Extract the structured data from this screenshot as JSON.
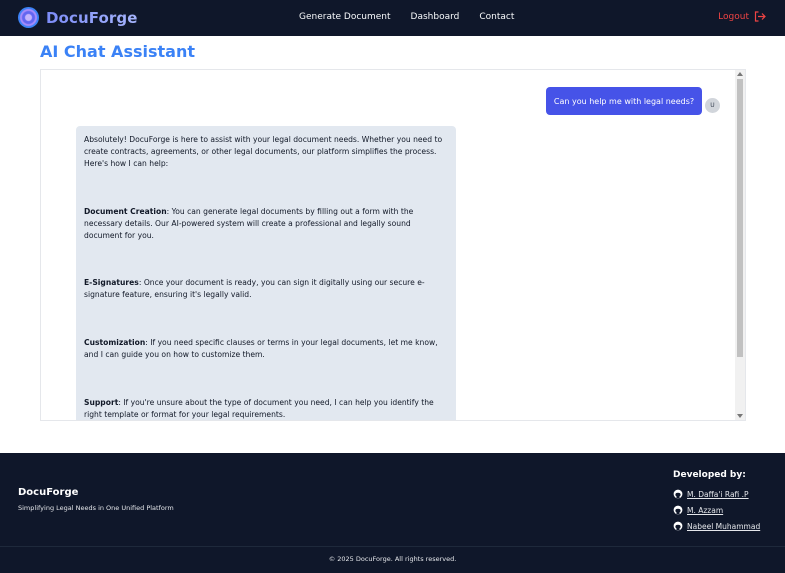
{
  "header": {
    "brand": "DocuForge",
    "nav": [
      "Generate Document",
      "Dashboard",
      "Contact"
    ],
    "logout": "Logout"
  },
  "page": {
    "title": "AI Chat Assistant"
  },
  "chat": {
    "user_message": "Can you help me with legal needs?",
    "user_avatar": "U",
    "ai_intro": "Absolutely! DocuForge is here to assist with your legal document needs. Whether you need to create contracts, agreements, or other legal documents, our platform simplifies the process. Here's how I can help:",
    "ai_points": [
      {
        "title": "Document Creation",
        "text": ": You can generate legal documents by filling out a form with the necessary details. Our AI-powered system will create a professional and legally sound document for you."
      },
      {
        "title": "E-Signatures",
        "text": ": Once your document is ready, you can sign it digitally using our secure e-signature feature, ensuring it's legally valid."
      },
      {
        "title": "Customization",
        "text": ": If you need specific clauses or terms in your legal documents, let me know, and I can guide you on how to customize them."
      },
      {
        "title": "Support",
        "text": ": If you're unsure about the type of document you need, I can help you identify the right template or format for your legal requirements."
      }
    ]
  },
  "footer": {
    "brand": "DocuForge",
    "tagline": "Simplifying Legal Needs in One Unified Platform",
    "developed_by": "Developed by:",
    "developers": [
      "M. Daffa'i Rafi .P",
      "M. Azzam",
      "Nabeel Muhammad"
    ],
    "copyright": "© 2025 DocuForge. All rights reserved."
  },
  "icons": {
    "logo": "docuforge-logo-icon",
    "logout": "logout-icon",
    "github": "github-icon"
  },
  "colors": {
    "nav_bg": "#0f172a",
    "accent": "#3b82f6",
    "user_bubble": "#4653e8",
    "ai_bubble": "#e2e8f0",
    "logout": "#ef4444"
  }
}
